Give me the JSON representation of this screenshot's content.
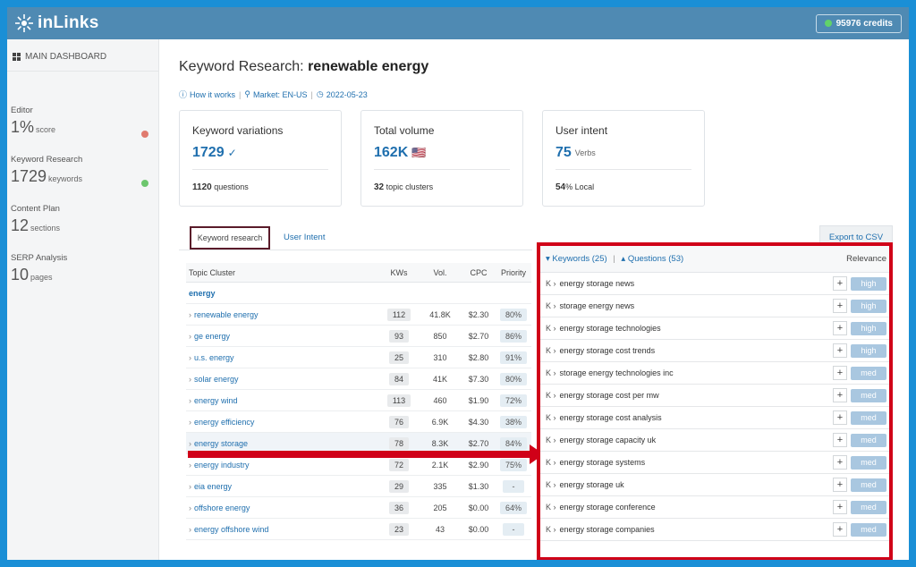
{
  "app": {
    "logo_text": "inLinks",
    "credits": "95976 credits"
  },
  "sidebar": {
    "dashboard": "MAIN DASHBOARD",
    "items": [
      {
        "label": "Editor",
        "value": "1%",
        "unit": "score",
        "indicator": "#e07a6e"
      },
      {
        "label": "Keyword Research",
        "value": "1729",
        "unit": "keywords",
        "indicator": "#6cc66d"
      },
      {
        "label": "Content Plan",
        "value": "12",
        "unit": "sections"
      },
      {
        "label": "SERP Analysis",
        "value": "10",
        "unit": "pages"
      }
    ]
  },
  "header": {
    "title_prefix": "Keyword Research:",
    "title_bold": "renewable energy",
    "meta": [
      "How it works",
      "Market: EN-US",
      "2022-05-23"
    ]
  },
  "cards": [
    {
      "title": "Keyword variations",
      "value": "1729",
      "suffix": "✓",
      "foot_bold": "1120",
      "foot": "questions"
    },
    {
      "title": "Total volume",
      "value": "162K",
      "suffix": "🇺🇸",
      "foot_bold": "32",
      "foot": "topic clusters"
    },
    {
      "title": "User intent",
      "value": "75",
      "suffix": "Verbs",
      "foot_bold": "54",
      "foot": "% Local"
    }
  ],
  "tabs": {
    "active": "Keyword research",
    "other": "User Intent",
    "export": "Export to CSV"
  },
  "table": {
    "headers": [
      "Topic Cluster",
      "KWs",
      "Vol.",
      "CPC",
      "Priority"
    ],
    "group": "energy",
    "rows": [
      {
        "name": "renewable energy",
        "kws": "112",
        "vol": "41.8K",
        "cpc": "$2.30",
        "pri": "80%"
      },
      {
        "name": "ge energy",
        "kws": "93",
        "vol": "850",
        "cpc": "$2.70",
        "pri": "86%"
      },
      {
        "name": "u.s. energy",
        "kws": "25",
        "vol": "310",
        "cpc": "$2.80",
        "pri": "91%"
      },
      {
        "name": "solar energy",
        "kws": "84",
        "vol": "41K",
        "cpc": "$7.30",
        "pri": "80%"
      },
      {
        "name": "energy wind",
        "kws": "113",
        "vol": "460",
        "cpc": "$1.90",
        "pri": "72%"
      },
      {
        "name": "energy efficiency",
        "kws": "76",
        "vol": "6.9K",
        "cpc": "$4.30",
        "pri": "38%"
      },
      {
        "name": "energy storage",
        "kws": "78",
        "vol": "8.3K",
        "cpc": "$2.70",
        "pri": "84%"
      },
      {
        "name": "energy industry",
        "kws": "72",
        "vol": "2.1K",
        "cpc": "$2.90",
        "pri": "75%"
      },
      {
        "name": "eia energy",
        "kws": "29",
        "vol": "335",
        "cpc": "$1.30",
        "pri": "-"
      },
      {
        "name": "offshore energy",
        "kws": "36",
        "vol": "205",
        "cpc": "$0.00",
        "pri": "64%"
      },
      {
        "name": "energy offshore wind",
        "kws": "23",
        "vol": "43",
        "cpc": "$0.00",
        "pri": "-"
      }
    ]
  },
  "keywords_panel": {
    "keywords_toggle": "Keywords (25)",
    "questions_toggle": "Questions (53)",
    "relevance_header": "Relevance",
    "k_label": "K",
    "rows": [
      {
        "text": "energy storage news",
        "rel": "high"
      },
      {
        "text": "storage energy news",
        "rel": "high"
      },
      {
        "text": "energy storage technologies",
        "rel": "high"
      },
      {
        "text": "energy storage cost trends",
        "rel": "high"
      },
      {
        "text": "storage energy technologies inc",
        "rel": "med"
      },
      {
        "text": "energy storage cost per mw",
        "rel": "med"
      },
      {
        "text": "energy storage cost analysis",
        "rel": "med"
      },
      {
        "text": "energy storage capacity uk",
        "rel": "med"
      },
      {
        "text": "energy storage systems",
        "rel": "med"
      },
      {
        "text": "energy storage uk",
        "rel": "med"
      },
      {
        "text": "energy storage conference",
        "rel": "med"
      },
      {
        "text": "energy storage companies",
        "rel": "med"
      }
    ]
  }
}
